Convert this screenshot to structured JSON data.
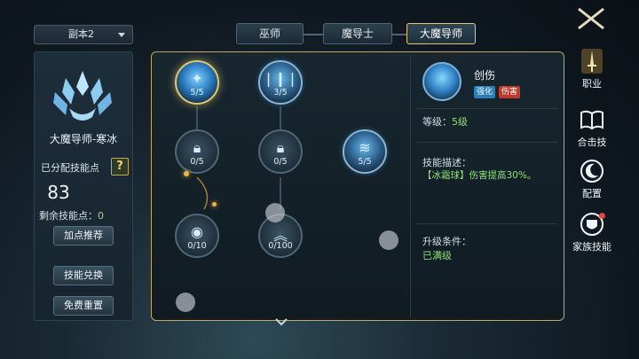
{
  "dropdown": {
    "value": "副本2"
  },
  "tabs": [
    {
      "label": "巫师"
    },
    {
      "label": "魔导士"
    },
    {
      "label": "大魔导师"
    }
  ],
  "left": {
    "class_name": "大魔导师-寒冰",
    "allocated_label": "已分配技能点",
    "help": "?",
    "allocated_points": "83",
    "remaining_label": "剩余技能点：",
    "remaining_value": "0",
    "btn_recommend": "加点推荐",
    "btn_exchange": "技能兑换",
    "btn_reset": "免费重置"
  },
  "skills": [
    {
      "level": "5/5"
    },
    {
      "level": "3/5"
    },
    {
      "level": "0/5"
    },
    {
      "level": "0/5"
    },
    {
      "level": "5/5"
    },
    {
      "level": "0/10"
    },
    {
      "level": "0/100"
    }
  ],
  "detail": {
    "title": "创伤",
    "tag1": "强化",
    "tag2": "伤害",
    "level_label": "等级：",
    "level_value": "5级",
    "desc_label": "技能描述：",
    "desc_text": "【冰霜球】伤害提高30%。",
    "req_label": "升级条件：",
    "req_value": "已满级"
  },
  "sidebar": [
    {
      "label": "职业"
    },
    {
      "label": "合击技"
    },
    {
      "label": "配置"
    },
    {
      "label": "家族技能"
    }
  ],
  "colors": {
    "accent_gold": "#e2c97a",
    "green": "#8ee07a",
    "tag_blue": "#2a7fb8",
    "tag_red": "#c0392b"
  },
  "icons": [
    "close-cross-icon",
    "chevron-down-icon",
    "ice-sword-icon",
    "lock-icon",
    "book-icon",
    "moon-icon",
    "shield-face-icon"
  ]
}
